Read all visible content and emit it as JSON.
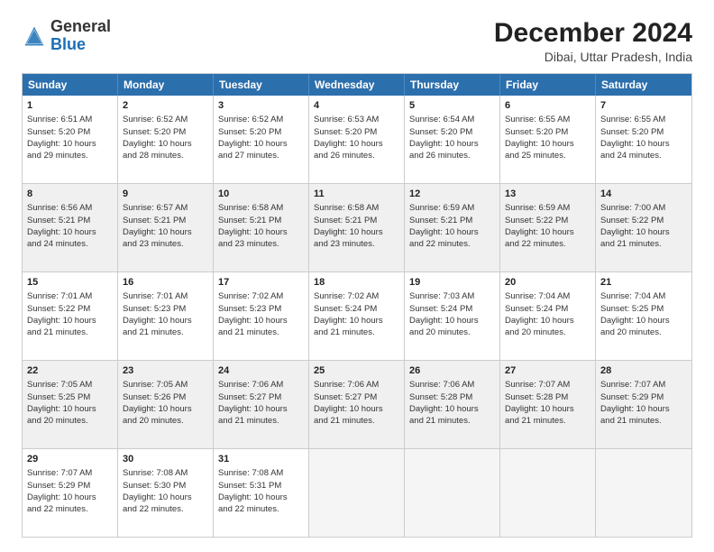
{
  "logo": {
    "general": "General",
    "blue": "Blue"
  },
  "header": {
    "month_year": "December 2024",
    "location": "Dibai, Uttar Pradesh, India"
  },
  "weekdays": [
    "Sunday",
    "Monday",
    "Tuesday",
    "Wednesday",
    "Thursday",
    "Friday",
    "Saturday"
  ],
  "rows": [
    [
      {
        "day": "1",
        "line1": "Sunrise: 6:51 AM",
        "line2": "Sunset: 5:20 PM",
        "line3": "Daylight: 10 hours",
        "line4": "and 29 minutes.",
        "empty": false,
        "shaded": false
      },
      {
        "day": "2",
        "line1": "Sunrise: 6:52 AM",
        "line2": "Sunset: 5:20 PM",
        "line3": "Daylight: 10 hours",
        "line4": "and 28 minutes.",
        "empty": false,
        "shaded": false
      },
      {
        "day": "3",
        "line1": "Sunrise: 6:52 AM",
        "line2": "Sunset: 5:20 PM",
        "line3": "Daylight: 10 hours",
        "line4": "and 27 minutes.",
        "empty": false,
        "shaded": false
      },
      {
        "day": "4",
        "line1": "Sunrise: 6:53 AM",
        "line2": "Sunset: 5:20 PM",
        "line3": "Daylight: 10 hours",
        "line4": "and 26 minutes.",
        "empty": false,
        "shaded": false
      },
      {
        "day": "5",
        "line1": "Sunrise: 6:54 AM",
        "line2": "Sunset: 5:20 PM",
        "line3": "Daylight: 10 hours",
        "line4": "and 26 minutes.",
        "empty": false,
        "shaded": false
      },
      {
        "day": "6",
        "line1": "Sunrise: 6:55 AM",
        "line2": "Sunset: 5:20 PM",
        "line3": "Daylight: 10 hours",
        "line4": "and 25 minutes.",
        "empty": false,
        "shaded": false
      },
      {
        "day": "7",
        "line1": "Sunrise: 6:55 AM",
        "line2": "Sunset: 5:20 PM",
        "line3": "Daylight: 10 hours",
        "line4": "and 24 minutes.",
        "empty": false,
        "shaded": false
      }
    ],
    [
      {
        "day": "8",
        "line1": "Sunrise: 6:56 AM",
        "line2": "Sunset: 5:21 PM",
        "line3": "Daylight: 10 hours",
        "line4": "and 24 minutes.",
        "empty": false,
        "shaded": true
      },
      {
        "day": "9",
        "line1": "Sunrise: 6:57 AM",
        "line2": "Sunset: 5:21 PM",
        "line3": "Daylight: 10 hours",
        "line4": "and 23 minutes.",
        "empty": false,
        "shaded": true
      },
      {
        "day": "10",
        "line1": "Sunrise: 6:58 AM",
        "line2": "Sunset: 5:21 PM",
        "line3": "Daylight: 10 hours",
        "line4": "and 23 minutes.",
        "empty": false,
        "shaded": true
      },
      {
        "day": "11",
        "line1": "Sunrise: 6:58 AM",
        "line2": "Sunset: 5:21 PM",
        "line3": "Daylight: 10 hours",
        "line4": "and 23 minutes.",
        "empty": false,
        "shaded": true
      },
      {
        "day": "12",
        "line1": "Sunrise: 6:59 AM",
        "line2": "Sunset: 5:21 PM",
        "line3": "Daylight: 10 hours",
        "line4": "and 22 minutes.",
        "empty": false,
        "shaded": true
      },
      {
        "day": "13",
        "line1": "Sunrise: 6:59 AM",
        "line2": "Sunset: 5:22 PM",
        "line3": "Daylight: 10 hours",
        "line4": "and 22 minutes.",
        "empty": false,
        "shaded": true
      },
      {
        "day": "14",
        "line1": "Sunrise: 7:00 AM",
        "line2": "Sunset: 5:22 PM",
        "line3": "Daylight: 10 hours",
        "line4": "and 21 minutes.",
        "empty": false,
        "shaded": true
      }
    ],
    [
      {
        "day": "15",
        "line1": "Sunrise: 7:01 AM",
        "line2": "Sunset: 5:22 PM",
        "line3": "Daylight: 10 hours",
        "line4": "and 21 minutes.",
        "empty": false,
        "shaded": false
      },
      {
        "day": "16",
        "line1": "Sunrise: 7:01 AM",
        "line2": "Sunset: 5:23 PM",
        "line3": "Daylight: 10 hours",
        "line4": "and 21 minutes.",
        "empty": false,
        "shaded": false
      },
      {
        "day": "17",
        "line1": "Sunrise: 7:02 AM",
        "line2": "Sunset: 5:23 PM",
        "line3": "Daylight: 10 hours",
        "line4": "and 21 minutes.",
        "empty": false,
        "shaded": false
      },
      {
        "day": "18",
        "line1": "Sunrise: 7:02 AM",
        "line2": "Sunset: 5:24 PM",
        "line3": "Daylight: 10 hours",
        "line4": "and 21 minutes.",
        "empty": false,
        "shaded": false
      },
      {
        "day": "19",
        "line1": "Sunrise: 7:03 AM",
        "line2": "Sunset: 5:24 PM",
        "line3": "Daylight: 10 hours",
        "line4": "and 20 minutes.",
        "empty": false,
        "shaded": false
      },
      {
        "day": "20",
        "line1": "Sunrise: 7:04 AM",
        "line2": "Sunset: 5:24 PM",
        "line3": "Daylight: 10 hours",
        "line4": "and 20 minutes.",
        "empty": false,
        "shaded": false
      },
      {
        "day": "21",
        "line1": "Sunrise: 7:04 AM",
        "line2": "Sunset: 5:25 PM",
        "line3": "Daylight: 10 hours",
        "line4": "and 20 minutes.",
        "empty": false,
        "shaded": false
      }
    ],
    [
      {
        "day": "22",
        "line1": "Sunrise: 7:05 AM",
        "line2": "Sunset: 5:25 PM",
        "line3": "Daylight: 10 hours",
        "line4": "and 20 minutes.",
        "empty": false,
        "shaded": true
      },
      {
        "day": "23",
        "line1": "Sunrise: 7:05 AM",
        "line2": "Sunset: 5:26 PM",
        "line3": "Daylight: 10 hours",
        "line4": "and 20 minutes.",
        "empty": false,
        "shaded": true
      },
      {
        "day": "24",
        "line1": "Sunrise: 7:06 AM",
        "line2": "Sunset: 5:27 PM",
        "line3": "Daylight: 10 hours",
        "line4": "and 21 minutes.",
        "empty": false,
        "shaded": true
      },
      {
        "day": "25",
        "line1": "Sunrise: 7:06 AM",
        "line2": "Sunset: 5:27 PM",
        "line3": "Daylight: 10 hours",
        "line4": "and 21 minutes.",
        "empty": false,
        "shaded": true
      },
      {
        "day": "26",
        "line1": "Sunrise: 7:06 AM",
        "line2": "Sunset: 5:28 PM",
        "line3": "Daylight: 10 hours",
        "line4": "and 21 minutes.",
        "empty": false,
        "shaded": true
      },
      {
        "day": "27",
        "line1": "Sunrise: 7:07 AM",
        "line2": "Sunset: 5:28 PM",
        "line3": "Daylight: 10 hours",
        "line4": "and 21 minutes.",
        "empty": false,
        "shaded": true
      },
      {
        "day": "28",
        "line1": "Sunrise: 7:07 AM",
        "line2": "Sunset: 5:29 PM",
        "line3": "Daylight: 10 hours",
        "line4": "and 21 minutes.",
        "empty": false,
        "shaded": true
      }
    ],
    [
      {
        "day": "29",
        "line1": "Sunrise: 7:07 AM",
        "line2": "Sunset: 5:29 PM",
        "line3": "Daylight: 10 hours",
        "line4": "and 22 minutes.",
        "empty": false,
        "shaded": false
      },
      {
        "day": "30",
        "line1": "Sunrise: 7:08 AM",
        "line2": "Sunset: 5:30 PM",
        "line3": "Daylight: 10 hours",
        "line4": "and 22 minutes.",
        "empty": false,
        "shaded": false
      },
      {
        "day": "31",
        "line1": "Sunrise: 7:08 AM",
        "line2": "Sunset: 5:31 PM",
        "line3": "Daylight: 10 hours",
        "line4": "and 22 minutes.",
        "empty": false,
        "shaded": false
      },
      {
        "day": "",
        "line1": "",
        "line2": "",
        "line3": "",
        "line4": "",
        "empty": true,
        "shaded": false
      },
      {
        "day": "",
        "line1": "",
        "line2": "",
        "line3": "",
        "line4": "",
        "empty": true,
        "shaded": false
      },
      {
        "day": "",
        "line1": "",
        "line2": "",
        "line3": "",
        "line4": "",
        "empty": true,
        "shaded": false
      },
      {
        "day": "",
        "line1": "",
        "line2": "",
        "line3": "",
        "line4": "",
        "empty": true,
        "shaded": false
      }
    ]
  ]
}
